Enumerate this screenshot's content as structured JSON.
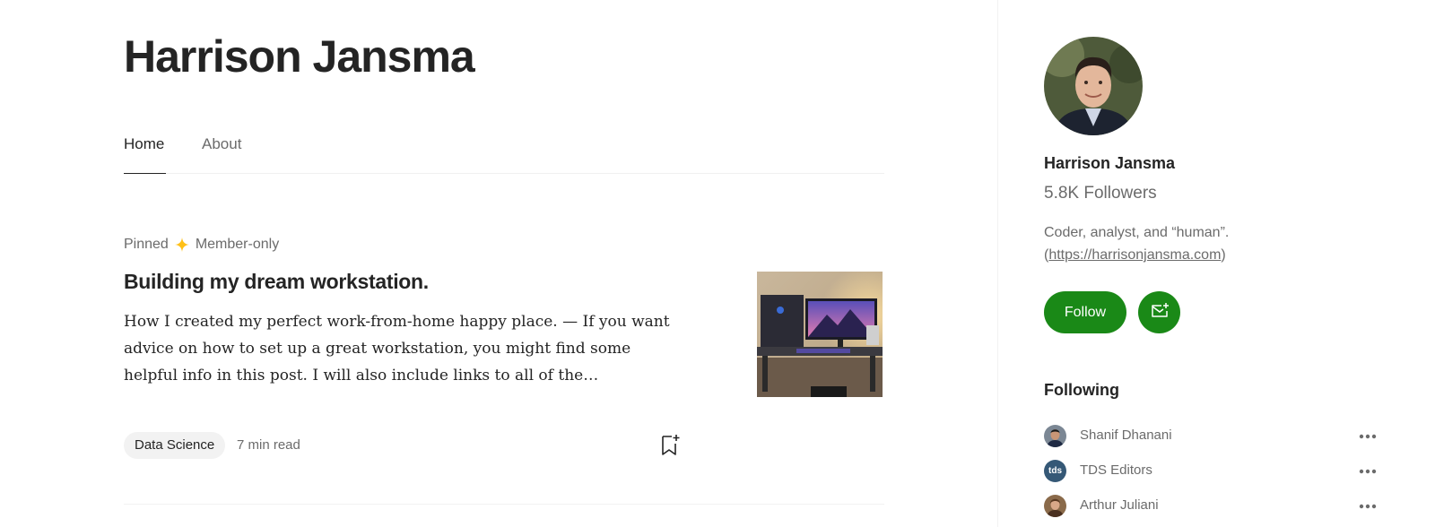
{
  "profile": {
    "name": "Harrison Jansma"
  },
  "tabs": [
    {
      "label": "Home",
      "active": true
    },
    {
      "label": "About",
      "active": false
    }
  ],
  "article": {
    "pinned_label": "Pinned",
    "member_label": "Member-only",
    "title": "Building my dream workstation.",
    "excerpt": "How I created my perfect work-from-home happy place. — If you want advice on how to set up a great workstation, you might find some helpful info in this post. I will also include links to all of the…",
    "tag": "Data Science",
    "read_time": "7 min read",
    "star_color": "#ffc017"
  },
  "sidebar": {
    "name": "Harrison Jansma",
    "followers": "5.8K Followers",
    "bio_text": "Coder, analyst, and “human”.",
    "bio_link_prefix": "(",
    "bio_link": "https://harrisonjansma.com",
    "bio_link_suffix": ")",
    "follow_label": "Follow",
    "accent_color": "#1a8917",
    "following_heading": "Following",
    "following": [
      {
        "name": "Shanif Dhanani",
        "avatar_text": ""
      },
      {
        "name": "TDS Editors",
        "avatar_text": "tds"
      },
      {
        "name": "Arthur Juliani",
        "avatar_text": ""
      }
    ]
  }
}
